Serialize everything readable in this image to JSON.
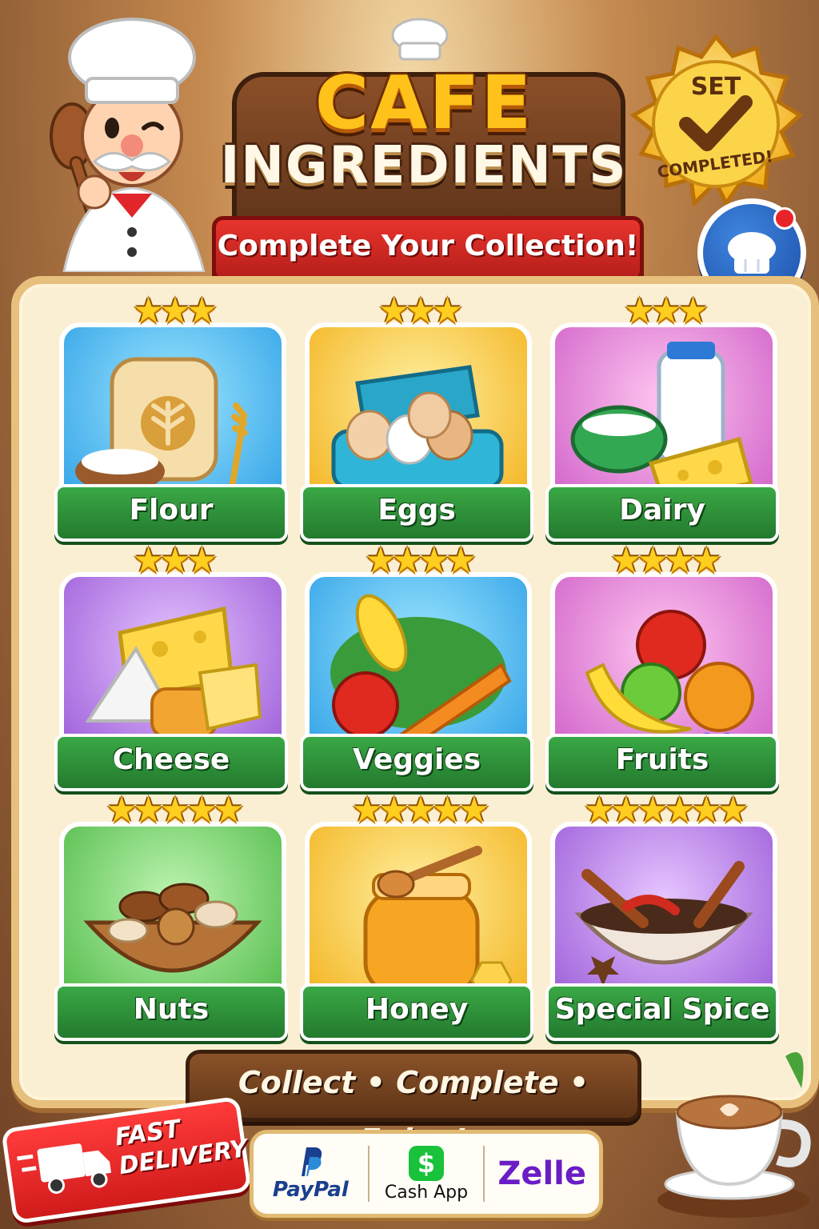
{
  "header": {
    "title_line1": "CAFE",
    "title_line2": "INGREDIENTS",
    "subtitle": "Complete Your Collection!",
    "badge_top": "SET",
    "badge_bottom": "COMPLETED!"
  },
  "cards": [
    {
      "label": "Flour",
      "stars": "★★★",
      "star_count": 3,
      "theme": "blue"
    },
    {
      "label": "Eggs",
      "stars": "★★★",
      "star_count": 3,
      "theme": "yellow"
    },
    {
      "label": "Dairy",
      "stars": "★★★",
      "star_count": 3,
      "theme": "pink"
    },
    {
      "label": "Cheese",
      "stars": "★★★",
      "star_count": 3,
      "theme": "purple"
    },
    {
      "label": "Veggies",
      "stars": "★★★★",
      "star_count": 4,
      "theme": "blue"
    },
    {
      "label": "Fruits",
      "stars": "★★★★",
      "star_count": 4,
      "theme": "pink"
    },
    {
      "label": "Nuts",
      "stars": "★★★★★",
      "star_count": 5,
      "theme": "green"
    },
    {
      "label": "Honey",
      "stars": "★★★★★",
      "star_count": 5,
      "theme": "yellow"
    },
    {
      "label": "Special Spice",
      "stars": "★★★★★★",
      "star_count": 6,
      "theme": "purple"
    }
  ],
  "footer": {
    "tagline": "Collect • Complete • Enjoy!",
    "fast_line1": "FAST",
    "fast_line2": "DELIVERY",
    "payments": {
      "paypal": "PayPal",
      "cashapp": "Cash App",
      "cashapp_symbol": "$",
      "zelle": "Zelle"
    }
  },
  "colors": {
    "accent_green": "#2f9a3b",
    "ribbon_red": "#d42a24",
    "title_gold": "#ffc21a",
    "board_cream": "#fbefd3"
  },
  "icons": [
    "chef-mascot",
    "chef-hat-icon",
    "check-icon",
    "truck-icon",
    "coffee-cup-icon",
    "star-icon"
  ]
}
